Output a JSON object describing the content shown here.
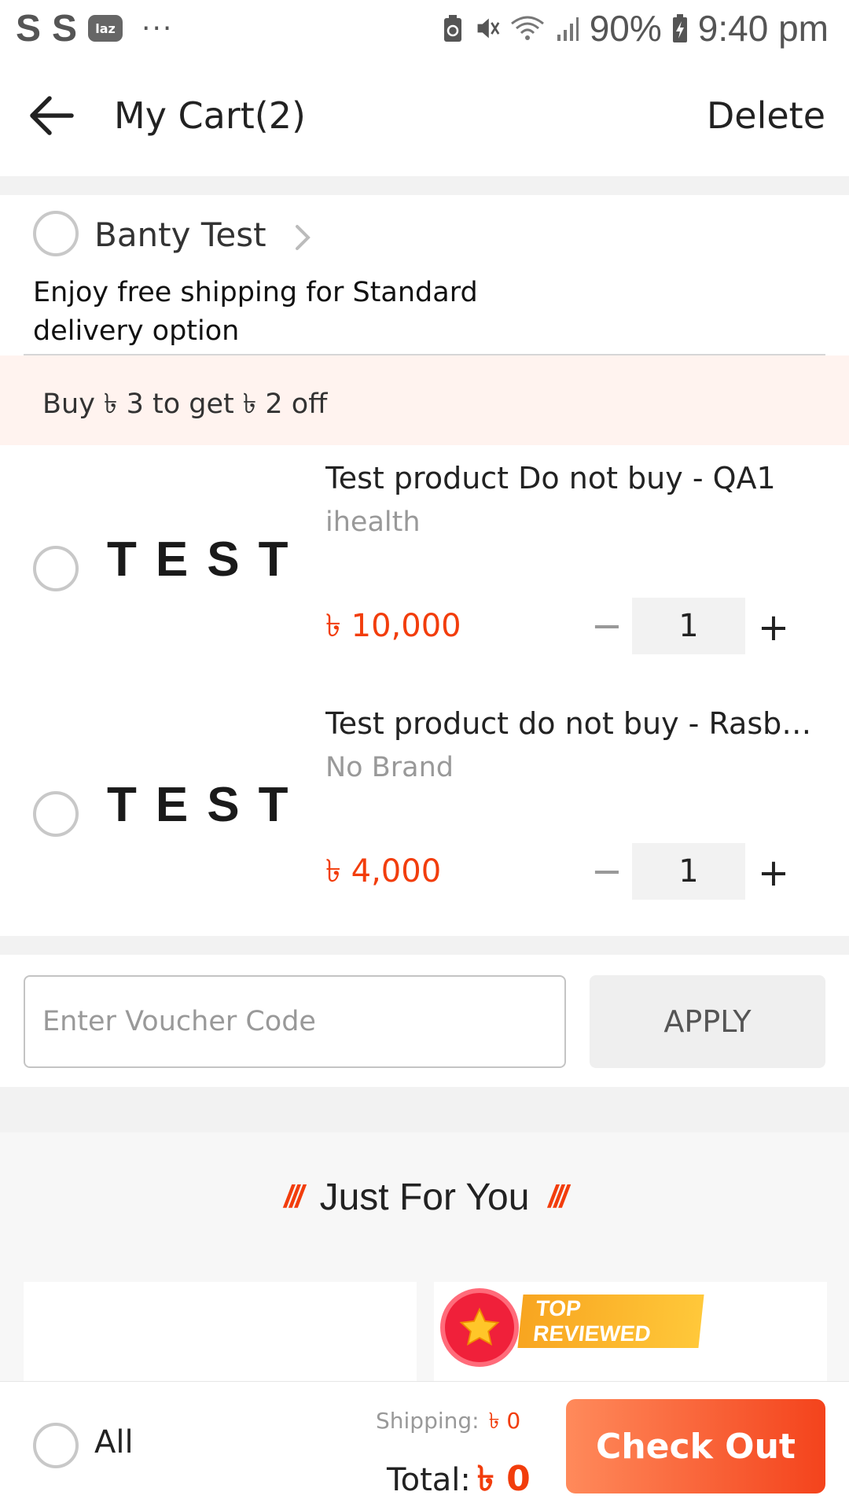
{
  "status_bar": {
    "left_letters": [
      "S",
      "S"
    ],
    "laz_badge": "laz",
    "more_dots": "···",
    "battery": "90%",
    "time": "9:40 pm",
    "icons": [
      "battery-saver-icon",
      "vibrate-mute-icon",
      "wifi-icon",
      "signal-icon",
      "battery-charging-icon"
    ]
  },
  "header": {
    "title": "My Cart(2)",
    "delete_label": "Delete"
  },
  "store": {
    "name": "Banty Test",
    "shipping_note": "Enjoy free shipping for Standard delivery option",
    "promo": "Buy ৳ 3 to get ৳ 2 off"
  },
  "items": [
    {
      "image_text": "TEST",
      "title": "Test product Do not buy - QA1",
      "brand": "ihealth",
      "price": "৳ 10,000",
      "quantity": "1",
      "minus": "−",
      "plus": "+"
    },
    {
      "image_text": "TEST",
      "title": "Test product do not buy - Rasberry...",
      "brand": "No Brand",
      "price": "৳ 4,000",
      "quantity": "1",
      "minus": "−",
      "plus": "+"
    }
  ],
  "voucher": {
    "placeholder": "Enter Voucher Code",
    "apply_label": "APPLY"
  },
  "just_for_you": {
    "title": "Just For You",
    "slashes": "///",
    "badge_text": "TOP REVIEWED"
  },
  "bottom_bar": {
    "all_label": "All",
    "shipping_label": "Shipping:",
    "shipping_value": "৳ 0",
    "total_label": "Total:",
    "total_value": "৳ 0",
    "checkout_label": "Check Out"
  },
  "colors": {
    "accent": "#f23d0c",
    "promo_bg": "#fff3ef",
    "checkout_gradient_start": "#ff8a5b",
    "checkout_gradient_end": "#f4431c"
  }
}
